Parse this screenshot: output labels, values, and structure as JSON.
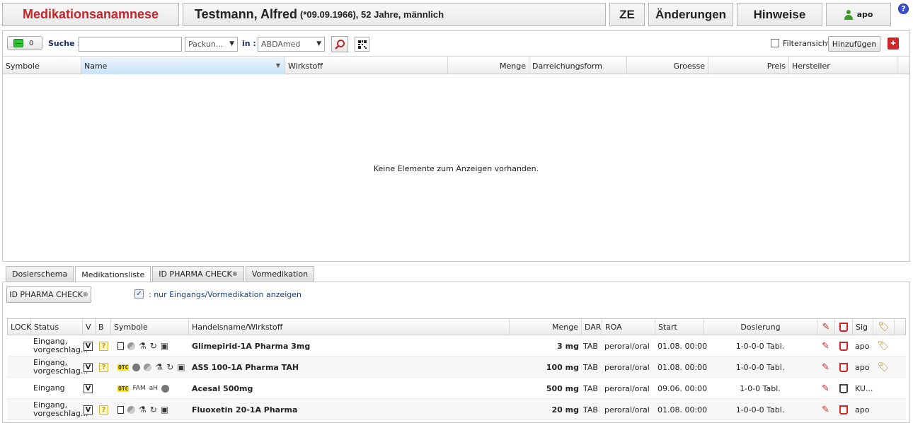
{
  "header": {
    "title": "Medikationsanamnese",
    "patient_name": "Testmann, Alfred",
    "patient_info": "(*09.09.1966), 52 Jahre, männlich",
    "ze_label": "ZE",
    "changes_label": "Änderungen",
    "notes_label": "Hinweise",
    "user_label": "apo",
    "help_label": "?"
  },
  "toolbar": {
    "counter_value": "0",
    "search_label": "Suche :",
    "search_value": "",
    "pack_select": "Packun...",
    "in_label": "in :",
    "db_select": "ABDAmed",
    "filter_label": "Filteransicht",
    "add_label": "Hinzufügen"
  },
  "search_grid": {
    "columns": [
      "Symbole",
      "Name",
      "Wirkstoff",
      "Menge",
      "Darreichungsform",
      "Groesse",
      "Preis",
      "Hersteller"
    ],
    "empty_message": "Keine Elemente zum Anzeigen vorhanden."
  },
  "tabs": [
    {
      "label": "Dosierschema"
    },
    {
      "label": "Medikationsliste"
    },
    {
      "label": "ID PHARMA CHECK",
      "sup": "®"
    },
    {
      "label": "Vormedikation"
    }
  ],
  "bottom": {
    "pharma_check_label": "ID PHARMA CHECK",
    "pharma_check_sup": "®",
    "nur_label": ": nur Eingangs/Vormedikation anzeigen"
  },
  "med_table": {
    "columns": [
      "LOCK",
      "Status",
      "V",
      "B",
      "Symbole",
      "Handelsname/Wirkstoff",
      "Menge",
      "DAR",
      "ROA",
      "Start",
      "Dosierung",
      "Sig"
    ],
    "rows": [
      {
        "status_line1": "Eingang,",
        "status_line2": "vorgeschlag...",
        "v": "V",
        "b": "?",
        "otc": "",
        "name": "Glimepirid-1A Pharma 3mg",
        "menge": "3 mg",
        "dar": "TAB",
        "roa": "peroral/oral",
        "start": "01.08. 00:00",
        "dosierung": "1-0-0-0 Tabl.",
        "sig": "apo"
      },
      {
        "status_line1": "Eingang,",
        "status_line2": "vorgeschlag...",
        "v": "V",
        "b": "?",
        "otc": "OTC",
        "name": "ASS 100-1A Pharma TAH",
        "menge": "100 mg",
        "dar": "TAB",
        "roa": "peroral/oral",
        "start": "01.08. 00:00",
        "dosierung": "1-0-0-0 Tabl.",
        "sig": "apo"
      },
      {
        "status_line1": "Eingang",
        "status_line2": "",
        "v": "V",
        "b": "",
        "otc": "OTC",
        "fam": "FAM",
        "ah": "aH",
        "name": "Acesal 500mg",
        "menge": "500 mg",
        "dar": "TAB",
        "roa": "peroral/oral",
        "start": "09.06. 00:00",
        "dosierung": "1-0-0 Tabl.",
        "sig": "KU..."
      },
      {
        "status_line1": "Eingang,",
        "status_line2": "vorgeschlag...",
        "v": "V",
        "b": "?",
        "otc": "",
        "name": "Fluoxetin 20-1A Pharma",
        "menge": "20 mg",
        "dar": "TAB",
        "roa": "peroral/oral",
        "start": "01.08. 00:00",
        "dosierung": "1-0-0-0 Tabl.",
        "sig": "apo"
      }
    ]
  }
}
